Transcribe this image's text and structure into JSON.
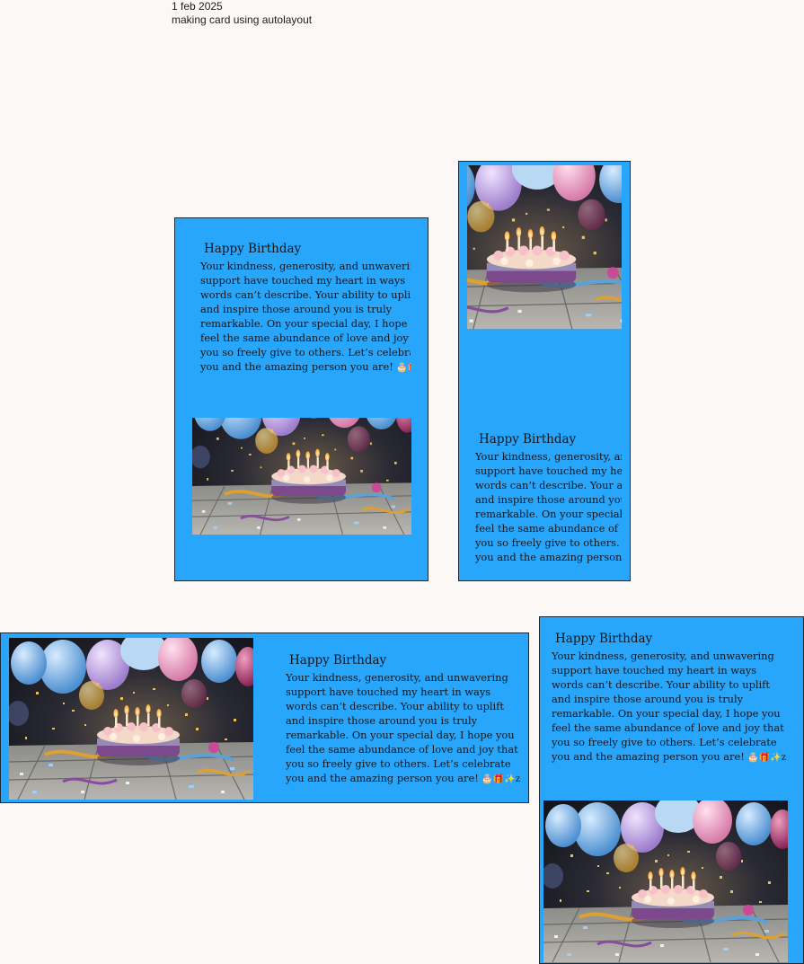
{
  "canvas": {
    "date": "1 feb 2025",
    "caption": "making card using autolayout"
  },
  "card": {
    "title": "Happy Birthday",
    "lines": [
      " Your kindness, generosity, and unwavering",
      "support have touched my heart in ways",
      "words can’t describe. Your ability to uplift",
      "and inspire those around you is truly",
      "remarkable. On your special day, I hope you",
      "feel the same abundance of love and joy that",
      "you so freely give to others. Let’s celebrate",
      "you and the amazing person you are! "
    ],
    "emoji_end": "🎂🎁✨z",
    "image_name": "birthday-cake-photo"
  },
  "colors": {
    "card": "#27a6fc",
    "border": "#1b2a3a",
    "canvas": "#fcf8f6",
    "ink": "#14161a"
  }
}
